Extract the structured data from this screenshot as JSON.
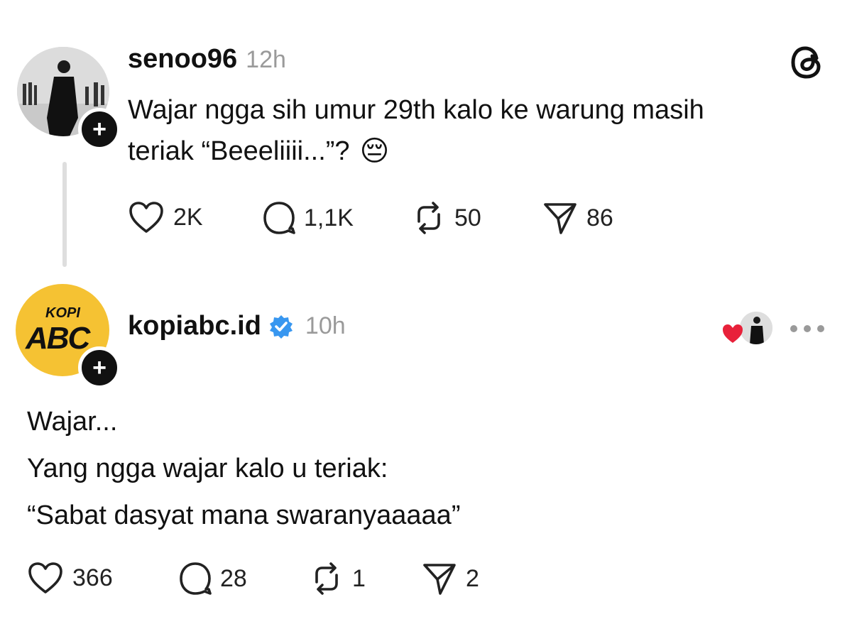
{
  "post1": {
    "username": "senoo96",
    "time": "12h",
    "text_line1": "Wajar ngga sih umur 29th kalo ke warung masih",
    "text_line2": "teriak “Beeeliiii...”?",
    "emoji": "😔",
    "stats": {
      "likes": "2K",
      "replies": "1,1K",
      "reposts": "50",
      "shares": "86"
    }
  },
  "post2": {
    "username": "kopiabc.id",
    "time": "10h",
    "logo_top": "KOPI",
    "logo_main": "ABC",
    "text_lines": [
      "Wajar...",
      "Yang ngga wajar kalo u teriak:",
      "“Sabat dasyat mana swaranyaaaaa”"
    ],
    "stats": {
      "likes": "366",
      "replies": "28",
      "reposts": "1",
      "shares": "2"
    }
  },
  "plus_symbol": "+",
  "icons": {
    "threads": "threads-logo-icon",
    "more": "more-options-icon",
    "verified": "verified-badge-icon",
    "heart": "heart-icon",
    "reply": "reply-bubble-icon",
    "repost": "repost-icon",
    "share": "share-send-icon"
  },
  "colors": {
    "verified": "#3897f0",
    "liked_heart": "#e8213a",
    "logo_yellow": "#f5c233",
    "muted": "#9a9a9a"
  }
}
